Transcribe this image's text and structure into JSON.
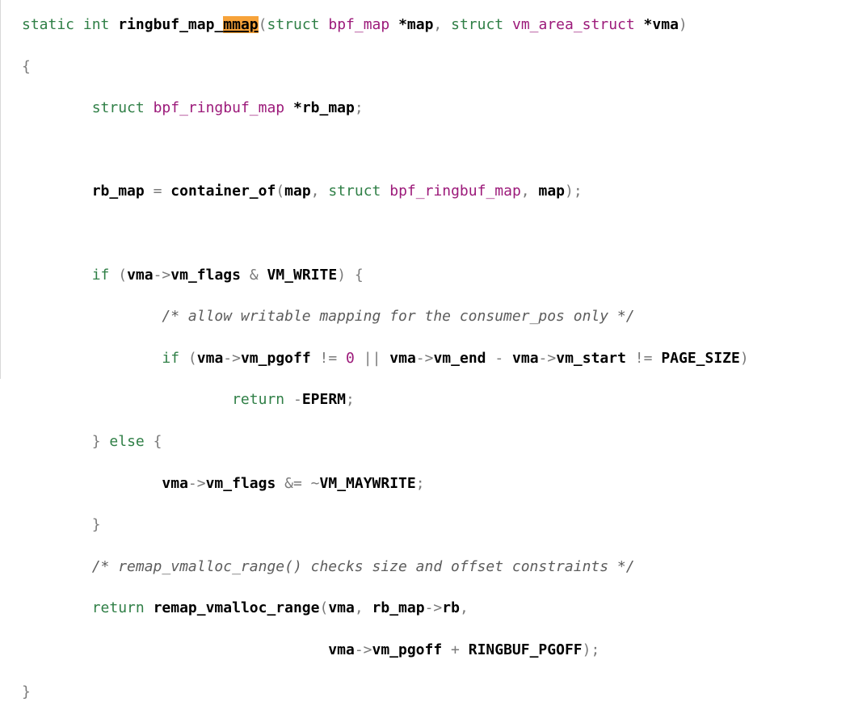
{
  "code": {
    "l1": {
      "kw_static": "static",
      "kw_int": "int",
      "fn_name_a": "ringbuf_map_",
      "fn_name_b": "mmap",
      "paren_open": "(",
      "kw_struct1": "struct",
      "ty_bpf_map": "bpf_map",
      "star1": "*",
      "id_map": "map",
      "comma1": ",",
      "kw_struct2": "struct",
      "ty_vm_area": "vm_area_struct",
      "star2": "*",
      "id_vma": "vma",
      "paren_close": ")"
    },
    "l2": {
      "brace_open": "{"
    },
    "l3": {
      "kw_struct": "struct",
      "ty_rb": "bpf_ringbuf_map",
      "star": "*",
      "id": "rb_map",
      "semi": ";"
    },
    "l5": {
      "id_rb_map": "rb_map",
      "eq": "=",
      "fn_container": "container_of",
      "paren_open": "(",
      "id_map": "map",
      "comma": ",",
      "kw_struct": "struct",
      "ty_rb": "bpf_ringbuf_map",
      "comma2": ",",
      "id_map2": "map",
      "paren_close": ")",
      "semi": ";"
    },
    "l7": {
      "kw_if": "if",
      "paren_open": "(",
      "id_vma": "vma",
      "arrow": "->",
      "id_flags": "vm_flags",
      "amp": "&",
      "id_write": "VM_WRITE",
      "paren_close": ")",
      "brace": "{"
    },
    "l8": {
      "comment": "/* allow writable mapping for the consumer_pos only */"
    },
    "l9": {
      "kw_if": "if",
      "paren_open": "(",
      "id_vma": "vma",
      "arrow": "->",
      "id_pgoff": "vm_pgoff",
      "neq": "!=",
      "num0": "0",
      "or": "||",
      "id_vma2": "vma",
      "arrow2": "->",
      "id_end": "vm_end",
      "minus": "-",
      "id_vma3": "vma",
      "arrow3": "->",
      "id_start": "vm_start",
      "neq2": "!=",
      "id_page": "PAGE_SIZE",
      "paren_close": ")"
    },
    "l10": {
      "kw_return": "return",
      "minus": "-",
      "id_eperm": "EPERM",
      "semi": ";"
    },
    "l11": {
      "brace_close": "}",
      "kw_else": "else",
      "brace_open": "{"
    },
    "l12": {
      "id_vma": "vma",
      "arrow": "->",
      "id_flags": "vm_flags",
      "andeq": "&=",
      "tilde": "~",
      "id_maywrite": "VM_MAYWRITE",
      "semi": ";"
    },
    "l13": {
      "brace_close": "}"
    },
    "l14": {
      "comment": "/* remap_vmalloc_range() checks size and offset constraints */"
    },
    "l15": {
      "kw_return": "return",
      "fn_remap": "remap_vmalloc_range",
      "paren_open": "(",
      "id_vma": "vma",
      "comma": ",",
      "id_rb_map": "rb_map",
      "arrow": "->",
      "id_rb": "rb",
      "comma2": ","
    },
    "l16": {
      "id_vma": "vma",
      "arrow": "->",
      "id_pgoff": "vm_pgoff",
      "plus": "+",
      "id_ringbuf_pgoff": "RINGBUF_PGOFF",
      "paren_close": ")",
      "semi": ";"
    },
    "l17": {
      "brace_close": "}"
    }
  }
}
